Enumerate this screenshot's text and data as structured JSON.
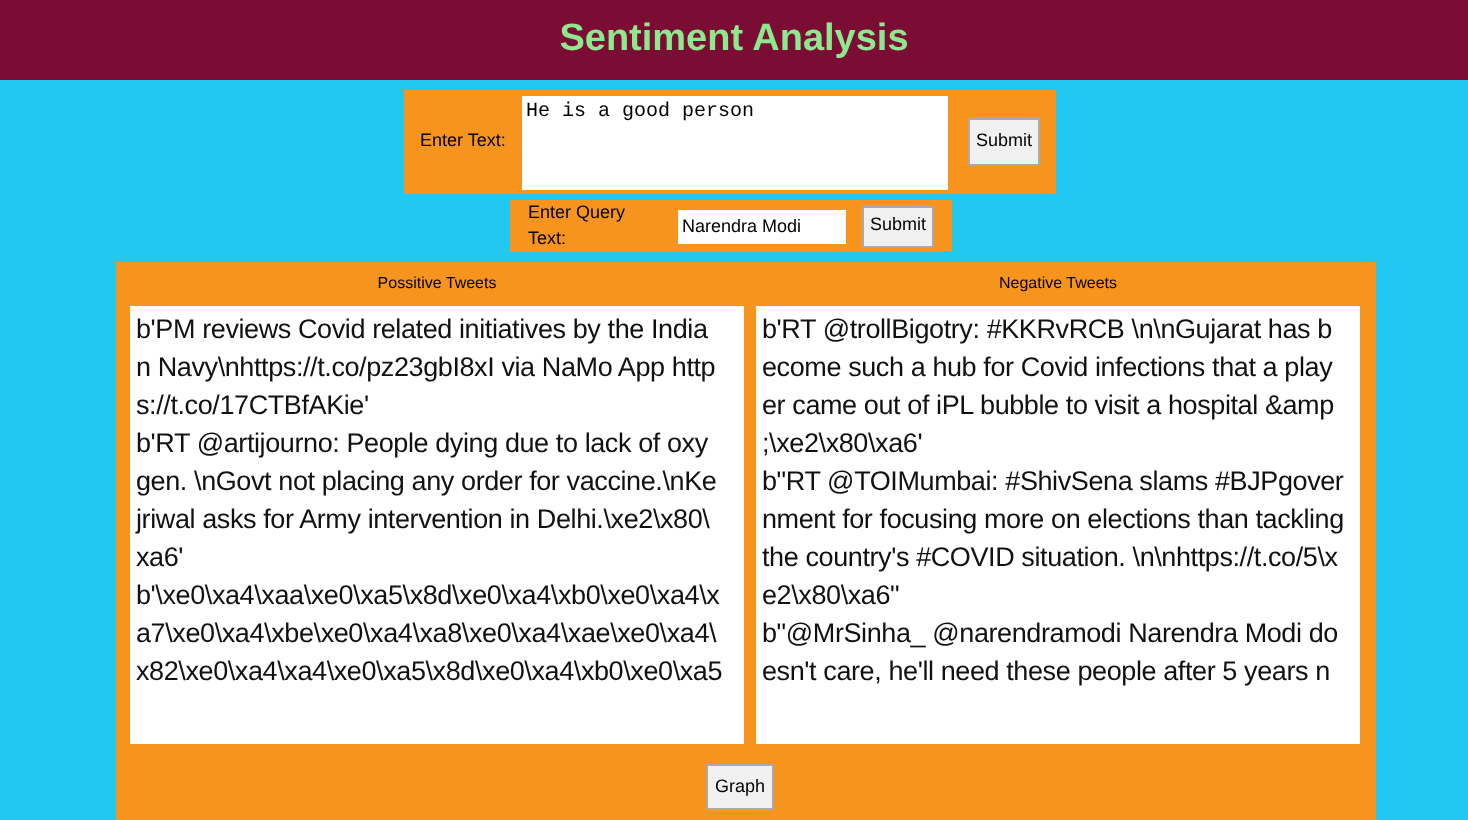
{
  "header": {
    "title": "Sentiment Analysis"
  },
  "text_form": {
    "label": "Enter Text:",
    "value": "He is a good person",
    "button": "Submit"
  },
  "query_form": {
    "label": "Enter Query Text:",
    "value": "Narendra Modi",
    "button": "Submit"
  },
  "positive": {
    "heading": "Possitive Tweets",
    "tweets": [
      {
        "lines": [
          "b'PM reviews Covid related initiatives by the India",
          "n Navy\\nhttps://t.co/pz23gbI8xI via NaMo App http",
          "s://t.co/17CTBfAKie'"
        ]
      },
      {
        "lines": [
          "b'RT @artijourno: People dying due to lack of oxy",
          "gen. \\nGovt not placing any order for vaccine.\\nKe",
          "jriwal asks for Army intervention in Delhi.\\xe2\\x80\\",
          "xa6'"
        ]
      },
      {
        "lines": [
          "b'\\xe0\\xa4\\xaa\\xe0\\xa5\\x8d\\xe0\\xa4\\xb0\\xe0\\xa4\\x",
          "a7\\xe0\\xa4\\xbe\\xe0\\xa4\\xa8\\xe0\\xa4\\xae\\xe0\\xa4\\",
          "x82\\xe0\\xa4\\xa4\\xe0\\xa5\\x8d\\xe0\\xa4\\xb0\\xe0\\xa5"
        ]
      }
    ]
  },
  "negative": {
    "heading": "Negative Tweets",
    "tweets": [
      {
        "lines": [
          "b'RT @trollBigotry: #KKRvRCB \\n\\nGujarat has b",
          "ecome such a hub for Covid infections that a play",
          "er came out of iPL bubble to visit a hospital &amp",
          ";\\xe2\\x80\\xa6'"
        ]
      },
      {
        "lines": [
          "b\"RT @TOIMumbai: #ShivSena slams #BJPgover",
          "nment for focusing more on elections than tackling",
          "the country's #COVID situation. \\n\\nhttps://t.co/5\\x",
          "e2\\x80\\xa6\""
        ]
      },
      {
        "lines": [
          "b\"@MrSinha_ @narendramodi Narendra Modi do",
          "esn't care, he'll need these people after 5 years n"
        ]
      }
    ]
  },
  "graph_button": "Graph"
}
